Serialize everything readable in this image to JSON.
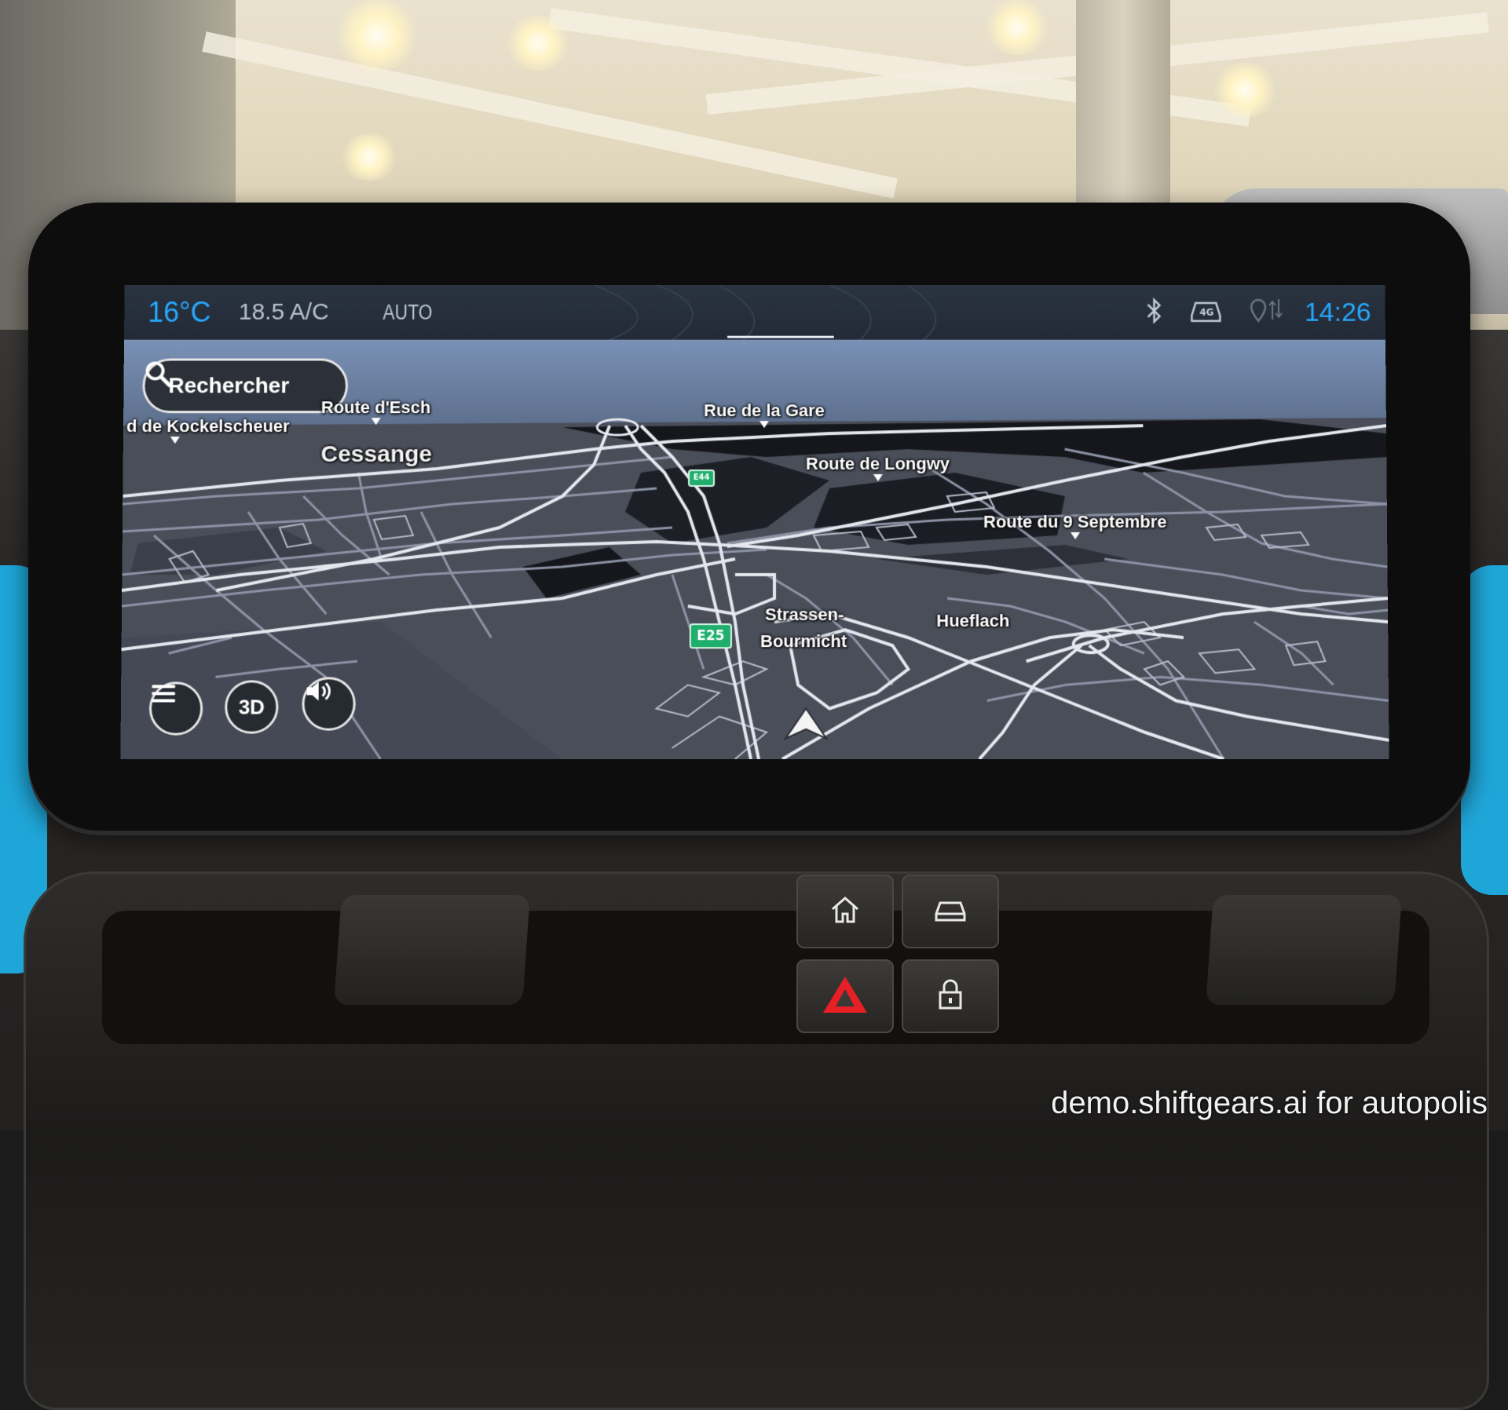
{
  "status_bar": {
    "temperature": "16°C",
    "ac_level": "18.5 A/C",
    "ac_mode": "AUTO",
    "time": "14:26",
    "icons": [
      "bluetooth-icon",
      "4g-car-icon",
      "location-sharing-icon"
    ],
    "accent_color": "#26a8ff"
  },
  "map": {
    "search_label": "Rechercher",
    "roads": [
      "Route de Kockelscheuer",
      "Route d'Esch",
      "Rue de la Gare",
      "Route de Longwy",
      "Route du 9 Septembre"
    ],
    "road_visible_text": "d de Kockelscheuer",
    "places": [
      "Cessange",
      "Strassen-",
      "Bourmicht",
      "Hueflach"
    ],
    "road_shields": [
      "E44",
      "E25"
    ],
    "controls": {
      "menu": "menu-icon",
      "view_mode": "3D",
      "sound": "speaker-icon"
    }
  },
  "hardware_buttons": [
    "home-icon",
    "car-icon",
    "hazard-icon",
    "lock-icon"
  ],
  "watermark": "demo.shiftgears.ai for autopolis"
}
